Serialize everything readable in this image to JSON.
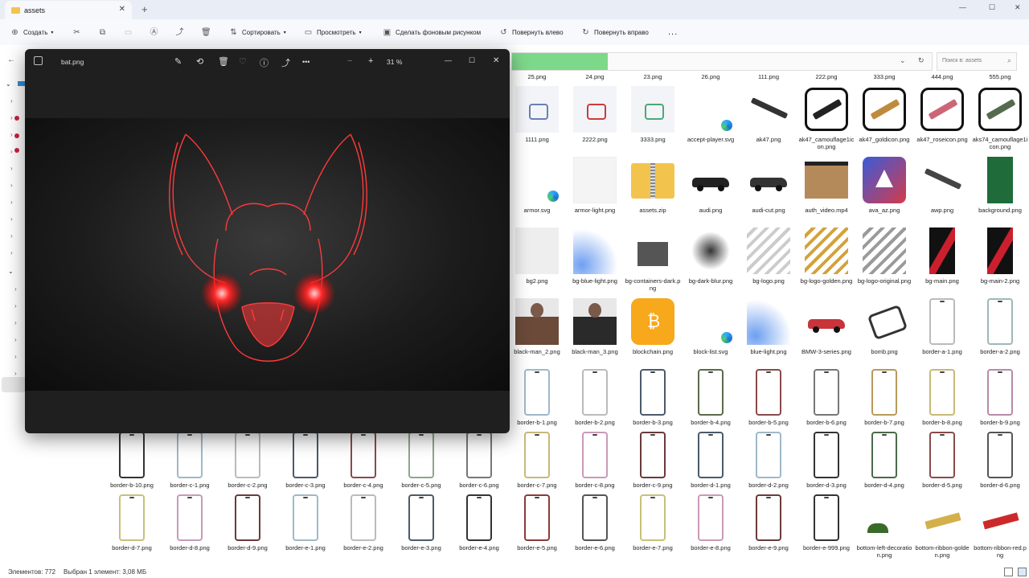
{
  "tab": {
    "title": "assets",
    "close": "✕",
    "new": "+"
  },
  "window_controls": [
    "—",
    "☐",
    "✕"
  ],
  "toolbar": {
    "create": "Создать",
    "sort": "Сортировать",
    "view": "Просмотреть",
    "set_wallpaper": "Сделать фоновым рисунком",
    "rotate_left": "Повернуть влево",
    "rotate_right": "Повернуть вправо",
    "more": "..."
  },
  "search": {
    "placeholder": "Поиск в: assets",
    "icon": "⌕"
  },
  "viewer": {
    "title": "bat.png",
    "zoom": "31 %",
    "icons": [
      "edit-icon",
      "rotate-icon",
      "delete-icon",
      "favorite-icon",
      "info-icon",
      "share-icon",
      "more-icon"
    ],
    "glyphs": [
      "✎",
      "⟲",
      "🗑",
      "♡",
      "ⓘ",
      "⤴",
      "•••"
    ],
    "controls": [
      "—",
      "☐",
      "✕"
    ],
    "zoom_out": "−",
    "zoom_in": "+"
  },
  "files_row0": [
    "25.png",
    "24.png",
    "23.png",
    "26.png",
    "111.png",
    "222.png",
    "333.png",
    "444.png",
    "555.png"
  ],
  "files": [
    {
      "name": "1111.png",
      "thumb": "badge",
      "color": "#6a7fb8"
    },
    {
      "name": "2222.png",
      "thumb": "badge",
      "color": "#cc3b3b"
    },
    {
      "name": "3333.png",
      "thumb": "badge",
      "color": "#4ba878"
    },
    {
      "name": "accept-player.svg",
      "thumb": "edge",
      "color": "#1e88c7"
    },
    {
      "name": "ak47.png",
      "thumb": "gun",
      "color": "#333333"
    },
    {
      "name": "ak47_camouflage1icon.png",
      "thumb": "gunbox",
      "color": "#222222"
    },
    {
      "name": "ak47_goldicon.png",
      "thumb": "gunbox",
      "color": "#c08a3e"
    },
    {
      "name": "ak47_roseicon.png",
      "thumb": "gunbox",
      "color": "#cc6677"
    },
    {
      "name": "aks74_camouflage1icon.png",
      "thumb": "gunbox",
      "color": "#556b4e"
    },
    {
      "name": "armor.svg",
      "thumb": "edge",
      "color": "#1e88c7"
    },
    {
      "name": "armor-light.png",
      "thumb": "blank",
      "color": "#f4f4f4"
    },
    {
      "name": "assets.zip",
      "thumb": "zip",
      "color": "#f3c44d"
    },
    {
      "name": "audi.png",
      "thumb": "car",
      "color": "#222222"
    },
    {
      "name": "audi-cut.png",
      "thumb": "car",
      "color": "#333333"
    },
    {
      "name": "auth_video.mp4",
      "thumb": "video",
      "color": "#b58a5a"
    },
    {
      "name": "ava_az.png",
      "thumb": "app",
      "color": "#d43b4b"
    },
    {
      "name": "awp.png",
      "thumb": "gun",
      "color": "#444444"
    },
    {
      "name": "background.png",
      "thumb": "solid",
      "color": "#1f6b3a"
    },
    {
      "name": "bg2.png",
      "thumb": "blank",
      "color": "#eeeeee"
    },
    {
      "name": "bg-blue-light.png",
      "thumb": "glow",
      "color": "#6e9ff0"
    },
    {
      "name": "bg-containers-dark.png",
      "thumb": "dark",
      "color": "#555555"
    },
    {
      "name": "bg-dark-blur.png",
      "thumb": "blur",
      "color": "#333333"
    },
    {
      "name": "bg-logo.png",
      "thumb": "stripes",
      "color": "#cccccc"
    },
    {
      "name": "bg-logo-golden.png",
      "thumb": "stripes",
      "color": "#d4a23a"
    },
    {
      "name": "bg-logo-original.png",
      "thumb": "stripes",
      "color": "#9a9a9a"
    },
    {
      "name": "bg-main.png",
      "thumb": "redblack",
      "color": "#cc1f2e"
    },
    {
      "name": "bg-main-2.png",
      "thumb": "redblack",
      "color": "#cc1f2e"
    },
    {
      "name": "black-man_2.png",
      "thumb": "person",
      "color": "#6b4a3a"
    },
    {
      "name": "black-man_3.png",
      "thumb": "person",
      "color": "#2a2a2a"
    },
    {
      "name": "blockchain.png",
      "thumb": "coin",
      "color": "#f7a81b"
    },
    {
      "name": "block-list.svg",
      "thumb": "edge",
      "color": "#1e88c7"
    },
    {
      "name": "blue-light.png",
      "thumb": "glow",
      "color": "#6e9ff0"
    },
    {
      "name": "BMW-3-series.png",
      "thumb": "car",
      "color": "#c7343a"
    },
    {
      "name": "bomb.png",
      "thumb": "bomb",
      "color": "#333333"
    },
    {
      "name": "border-a-1.png",
      "thumb": "phone",
      "color": "#bbbbbb"
    },
    {
      "name": "border-a-2.png",
      "thumb": "phone",
      "color": "#9fb8b8"
    },
    {
      "name": "border-b-1.png",
      "thumb": "phone",
      "color": "#9fb8c8"
    },
    {
      "name": "border-b-2.png",
      "thumb": "phone",
      "color": "#bbbbbb"
    },
    {
      "name": "border-b-3.png",
      "thumb": "phone",
      "color": "#4a5a6a"
    },
    {
      "name": "border-b-4.png",
      "thumb": "phone",
      "color": "#5a6a4a"
    },
    {
      "name": "border-b-5.png",
      "thumb": "phone",
      "color": "#8a4a4a"
    },
    {
      "name": "border-b-6.png",
      "thumb": "phone",
      "color": "#777777"
    },
    {
      "name": "border-b-7.png",
      "thumb": "phone",
      "color": "#b89a5a"
    },
    {
      "name": "border-b-8.png",
      "thumb": "phone",
      "color": "#c8b87a"
    },
    {
      "name": "border-b-9.png",
      "thumb": "phone",
      "color": "#b88aa8"
    },
    {
      "name": "border-b-10.png",
      "thumb": "phone",
      "color": "#333333"
    },
    {
      "name": "border-c-1.png",
      "thumb": "phone",
      "color": "#9fb8c8"
    },
    {
      "name": "border-c-2.png",
      "thumb": "phone",
      "color": "#bbbbbb"
    },
    {
      "name": "border-c-3.png",
      "thumb": "phone",
      "color": "#4a5a6a"
    },
    {
      "name": "border-c-4.png",
      "thumb": "phone",
      "color": "#8a4a4a"
    },
    {
      "name": "border-c-5.png",
      "thumb": "phone",
      "color": "#8aa88a"
    },
    {
      "name": "border-c-6.png",
      "thumb": "phone",
      "color": "#777777"
    },
    {
      "name": "border-c-7.png",
      "thumb": "phone",
      "color": "#c8b87a"
    },
    {
      "name": "border-c-8.png",
      "thumb": "phone",
      "color": "#c89ab8"
    },
    {
      "name": "border-c-9.png",
      "thumb": "phone",
      "color": "#6a3a3a"
    },
    {
      "name": "border-d-1.png",
      "thumb": "phone",
      "color": "#4a5a6a"
    },
    {
      "name": "border-d-2.png",
      "thumb": "phone",
      "color": "#9fb8c8"
    },
    {
      "name": "border-d-3.png",
      "thumb": "phone",
      "color": "#333333"
    },
    {
      "name": "border-d-4.png",
      "thumb": "phone",
      "color": "#4a6a4a"
    },
    {
      "name": "border-d-5.png",
      "thumb": "phone",
      "color": "#8a4a4a"
    },
    {
      "name": "border-d-6.png",
      "thumb": "phone",
      "color": "#555555"
    },
    {
      "name": "border-d-7.png",
      "thumb": "phone",
      "color": "#c8c07a"
    },
    {
      "name": "border-d-8.png",
      "thumb": "phone",
      "color": "#c89ab8"
    },
    {
      "name": "border-d-9.png",
      "thumb": "phone",
      "color": "#6a3a3a"
    },
    {
      "name": "border-e-1.png",
      "thumb": "phone",
      "color": "#9fb8c8"
    },
    {
      "name": "border-e-2.png",
      "thumb": "phone",
      "color": "#bbbbbb"
    },
    {
      "name": "border-e-3.png",
      "thumb": "phone",
      "color": "#4a5a6a"
    },
    {
      "name": "border-e-4.png",
      "thumb": "phone",
      "color": "#333333"
    },
    {
      "name": "border-e-5.png",
      "thumb": "phone",
      "color": "#8a3a3a"
    },
    {
      "name": "border-e-6.png",
      "thumb": "phone",
      "color": "#555555"
    },
    {
      "name": "border-e-7.png",
      "thumb": "phone",
      "color": "#c8c07a"
    },
    {
      "name": "border-e-8.png",
      "thumb": "phone",
      "color": "#c89ab8"
    },
    {
      "name": "border-e-9.png",
      "thumb": "phone",
      "color": "#6a3a3a"
    },
    {
      "name": "border-e-999.png",
      "thumb": "phone",
      "color": "#333333"
    },
    {
      "name": "bottom-left-decoration.png",
      "thumb": "deco",
      "color": "#3a6a2a"
    },
    {
      "name": "bottom-ribbon-golden.png",
      "thumb": "ribbon",
      "color": "#d4b04a"
    },
    {
      "name": "bottom-ribbon-red.png",
      "thumb": "ribbon",
      "color": "#cc2a2a"
    }
  ],
  "status": {
    "count": "Элементов: 772",
    "selected": "Выбран 1 элемент: 3,08 МБ"
  }
}
